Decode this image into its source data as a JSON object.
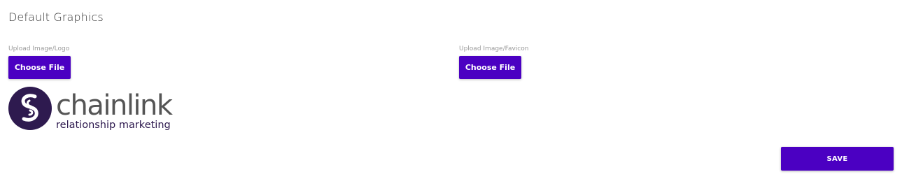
{
  "section": {
    "title": "Default Graphics"
  },
  "logo_upload": {
    "label": "Upload Image/Logo",
    "button_label": "Choose File"
  },
  "favicon_upload": {
    "label": "Upload Image/Favicon",
    "button_label": "Choose File"
  },
  "logo_preview": {
    "brand_name": "chainlink",
    "tagline": "relationship marketing",
    "brand_color": "#2e1a4f",
    "wordmark_color": "#555555"
  },
  "actions": {
    "save_label": "SAVE"
  },
  "colors": {
    "accent": "#4b00c2",
    "title_text": "#333333",
    "label_text": "#999999"
  }
}
